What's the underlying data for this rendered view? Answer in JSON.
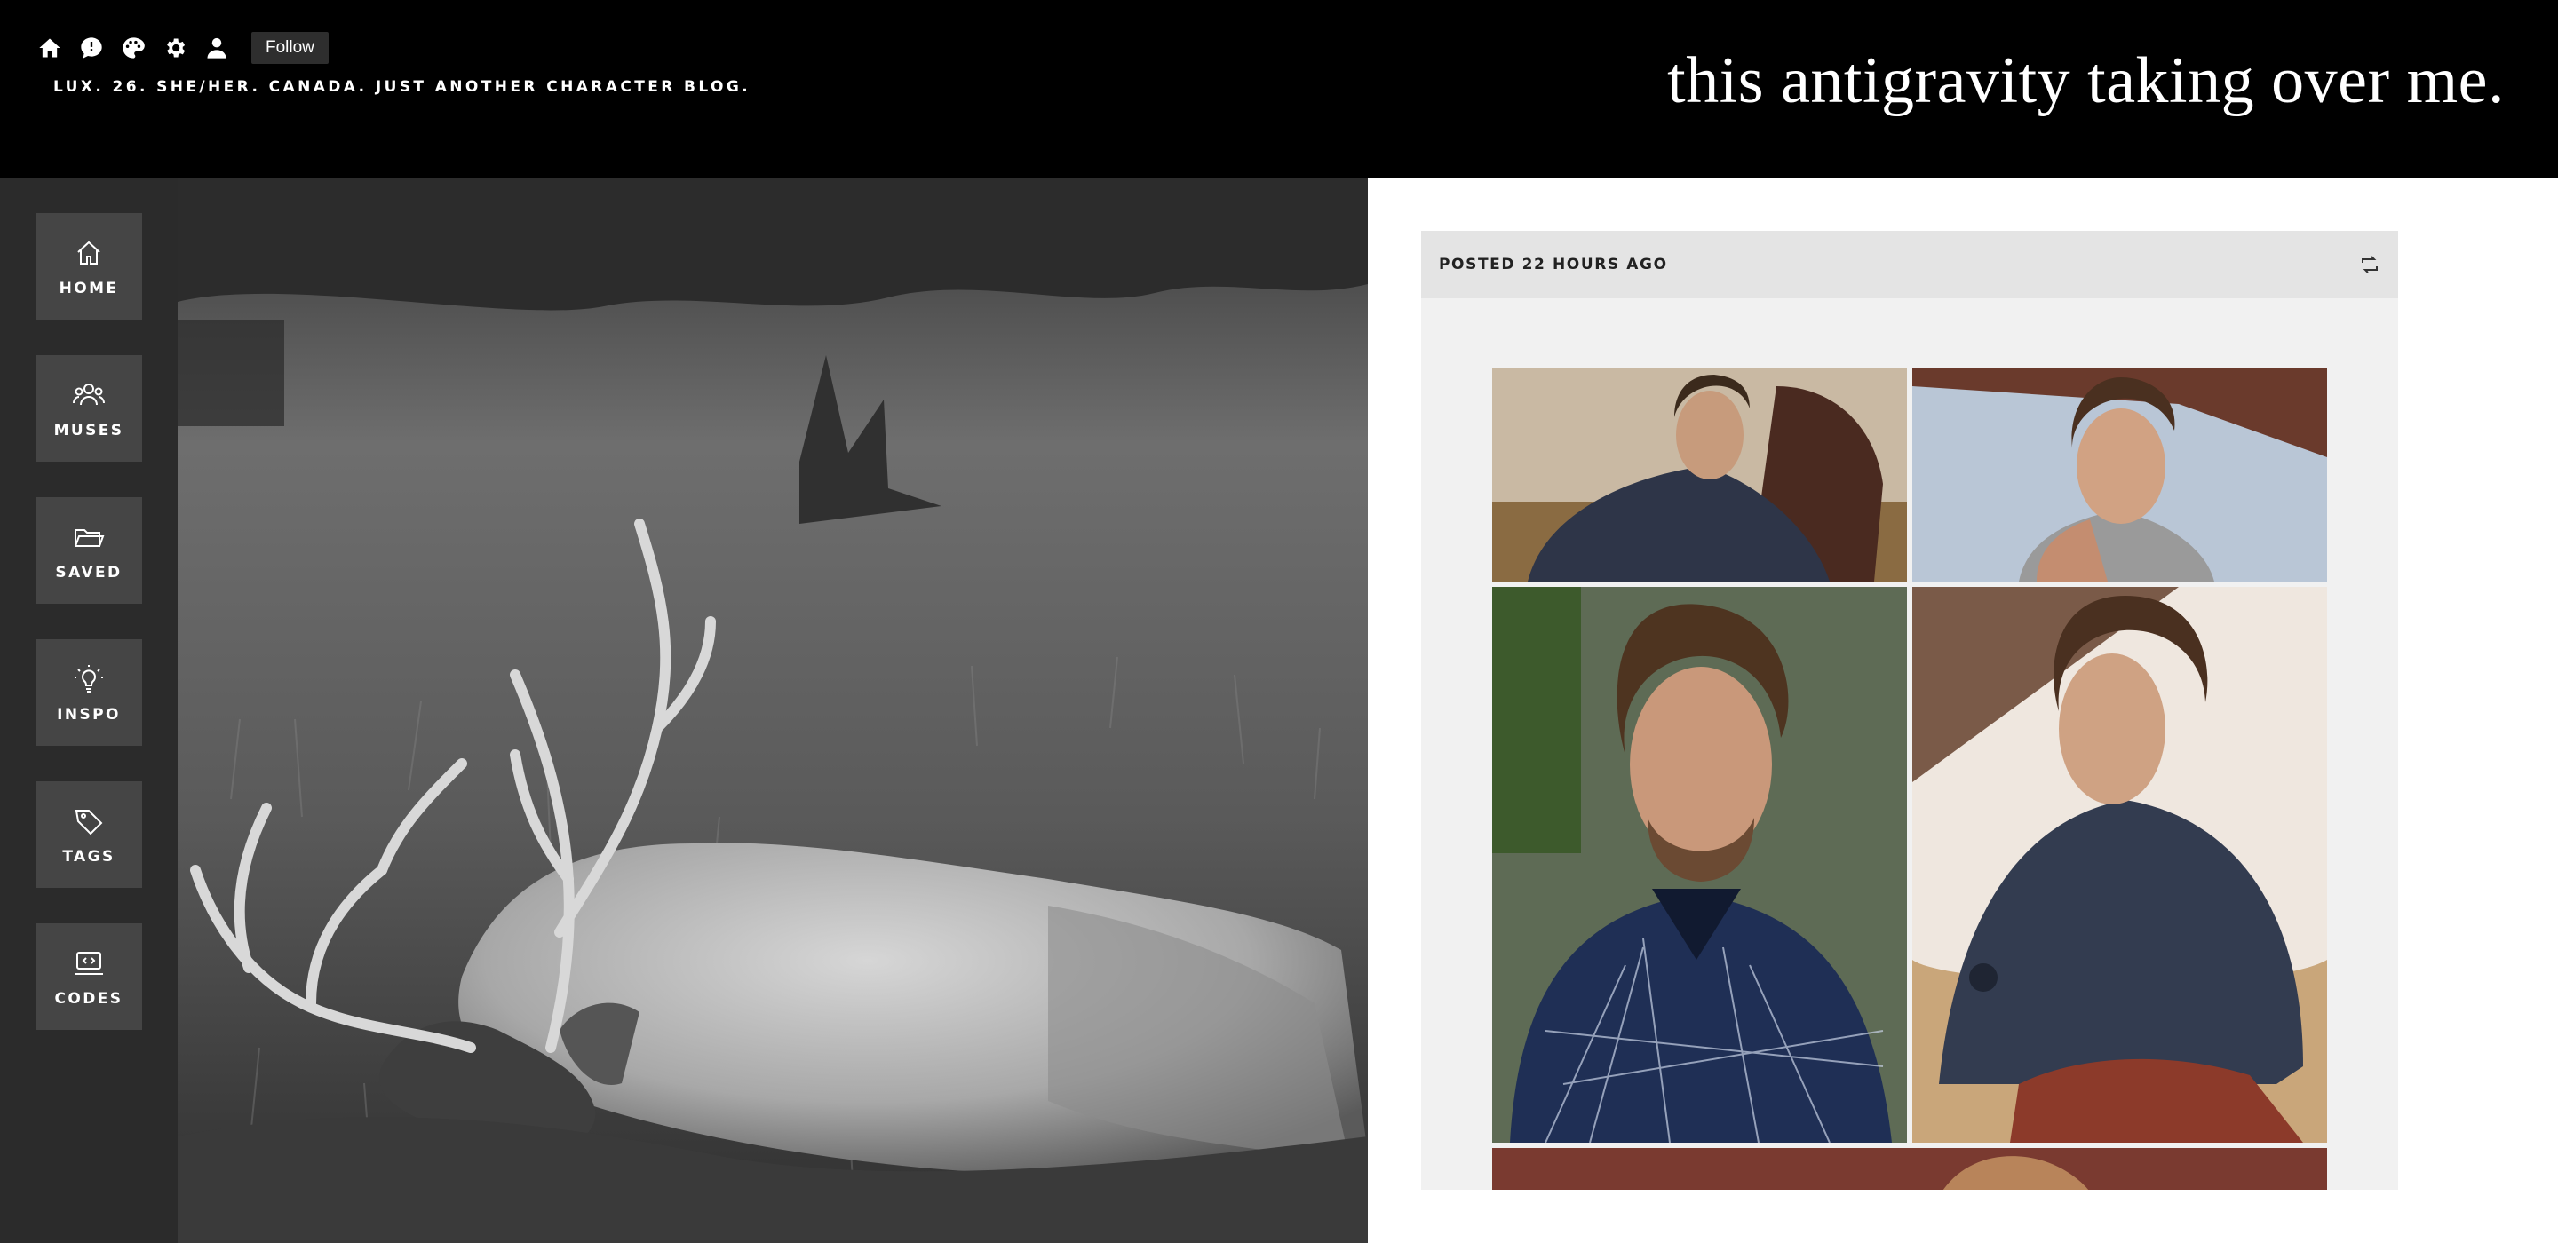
{
  "header": {
    "toolbar": {
      "icons": [
        "home-icon",
        "ask-icon",
        "palette-icon",
        "settings-icon",
        "user-icon"
      ],
      "follow_label": "Follow"
    },
    "description": "LUX. 26. SHE/HER. CANADA. JUST ANOTHER CHARACTER BLOG.",
    "title": "this antigravity taking over me."
  },
  "sidebar": {
    "items": [
      {
        "label": "HOME",
        "icon": "home-icon"
      },
      {
        "label": "MUSES",
        "icon": "users-icon"
      },
      {
        "label": "SAVED",
        "icon": "folder-icon"
      },
      {
        "label": "INSPO",
        "icon": "lightbulb-icon"
      },
      {
        "label": "TAGS",
        "icon": "tag-icon"
      },
      {
        "label": "CODES",
        "icon": "code-icon"
      }
    ]
  },
  "post": {
    "posted": "POSTED 22 HOURS AGO",
    "action_icon": "reblog-icon"
  },
  "colors": {
    "header_bg": "#000000",
    "sidebar_bg": "#2b2b2b",
    "nav_tile_bg": "#454545",
    "post_bg": "#f1f1f1",
    "post_header_bg": "#e4e4e4"
  }
}
